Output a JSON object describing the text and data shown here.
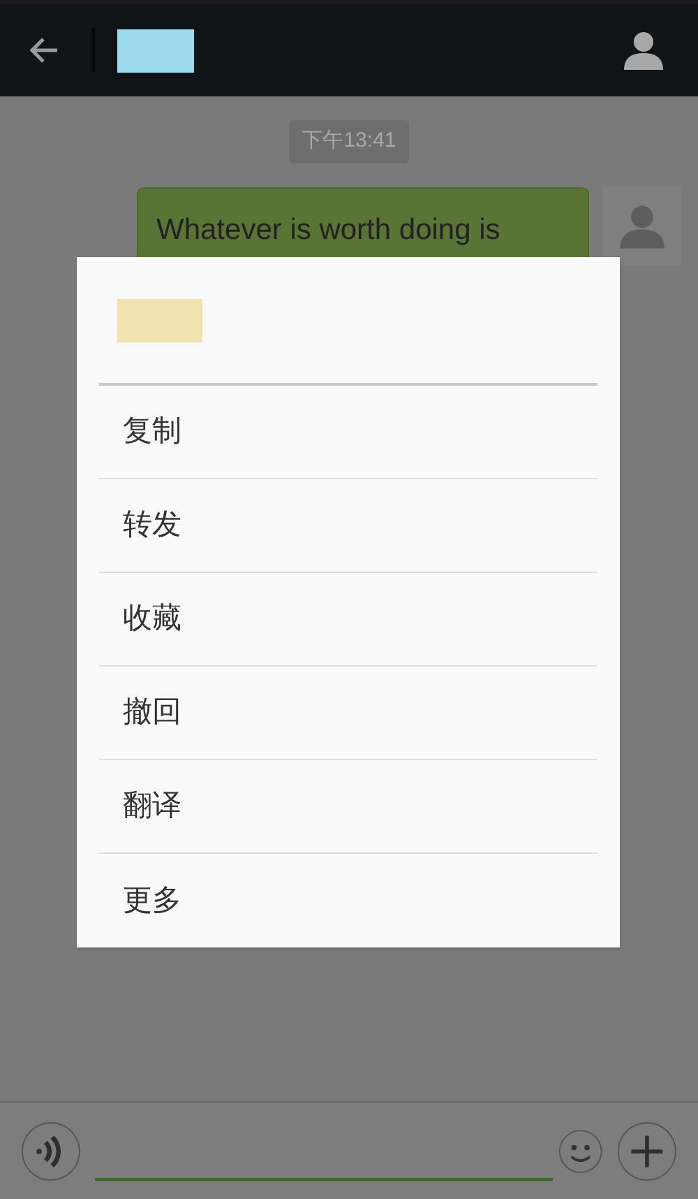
{
  "chat": {
    "timestamp": "下午13:41",
    "messages": [
      {
        "text": "Whatever is worth doing is"
      }
    ]
  },
  "context_menu": {
    "items": [
      {
        "label": "复制"
      },
      {
        "label": "转发"
      },
      {
        "label": "收藏"
      },
      {
        "label": "撤回"
      },
      {
        "label": "翻译"
      },
      {
        "label": "更多"
      }
    ]
  }
}
